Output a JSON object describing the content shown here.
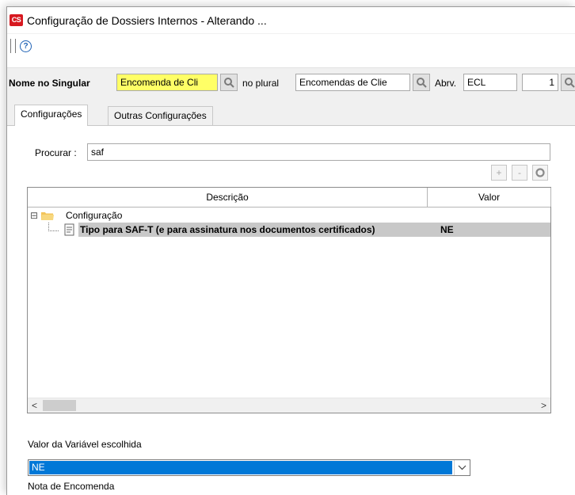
{
  "window": {
    "title": "Configuração de Dossiers Internos - Alterando ...",
    "app_icon_text": "CS"
  },
  "toolbar": {
    "help_icon": "?"
  },
  "name_bar": {
    "singular_label": "Nome no Singular",
    "singular_value": "Encomenda de Cli",
    "plural_label": "no plural",
    "plural_value": "Encomendas de Clie",
    "abbrev_label": "Abrv.",
    "abbrev_value": "ECL",
    "number_value": "1"
  },
  "tabs": [
    {
      "label": "Configurações",
      "active": true
    },
    {
      "label": "Outras Configurações",
      "active": false
    }
  ],
  "search": {
    "label": "Procurar :",
    "value": "saf"
  },
  "grid_buttons": {
    "add": "+",
    "remove": "-"
  },
  "grid": {
    "columns": [
      "Descrição",
      "Valor"
    ],
    "tree": {
      "group_label": "Configuração",
      "expander": "⊟",
      "rows": [
        {
          "label": "Tipo para SAF-T (e para assinatura nos documentos certificados)",
          "value": "NE",
          "selected": true
        }
      ]
    },
    "scroll_left": "<",
    "scroll_right": ">"
  },
  "variable": {
    "label": "Valor da Variável escolhida",
    "selected_value": "NE"
  },
  "note": {
    "text": "Nota de Encomenda"
  }
}
